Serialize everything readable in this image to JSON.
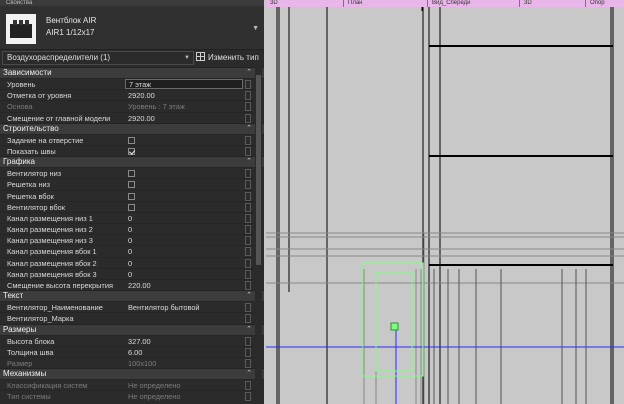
{
  "panel": {
    "title": "Свойства",
    "type_name": "Вентблок AIR",
    "type_sub": "AIR1 1/12x17",
    "filter": "Воздухораспределители (1)",
    "edit_type": "Изменить тип"
  },
  "sections": [
    {
      "title": "Зависимости",
      "rows": [
        {
          "label": "Уровень",
          "value": "7 этаж",
          "kind": "input"
        },
        {
          "label": "Отметка от уровня",
          "value": "2920.00"
        },
        {
          "label": "Основа",
          "value": "Уровень : 7 этаж",
          "kind": "disabled"
        },
        {
          "label": "Смещение от главной модели",
          "value": "2920.00"
        }
      ]
    },
    {
      "title": "Строительство",
      "rows": [
        {
          "label": "Задание на отверстие",
          "value": "",
          "kind": "checkbox",
          "checked": false
        },
        {
          "label": "Показать швы",
          "value": "",
          "kind": "checkbox",
          "checked": true
        }
      ]
    },
    {
      "title": "Графика",
      "rows": [
        {
          "label": "Вентилятор низ",
          "value": "",
          "kind": "checkbox",
          "checked": false
        },
        {
          "label": "Решетка низ",
          "value": "",
          "kind": "checkbox",
          "checked": false
        },
        {
          "label": "Решетка вбок",
          "value": "",
          "kind": "checkbox",
          "checked": false
        },
        {
          "label": "Вентилятор вбок",
          "value": "",
          "kind": "checkbox",
          "checked": false
        },
        {
          "label": "Канал размещения низ 1",
          "value": "0"
        },
        {
          "label": "Канал размещения низ 2",
          "value": "0"
        },
        {
          "label": "Канал размещения низ 3",
          "value": "0"
        },
        {
          "label": "Канал размещения вбок 1",
          "value": "0"
        },
        {
          "label": "Канал размещения вбок 2",
          "value": "0"
        },
        {
          "label": "Канал размещения вбок 3",
          "value": "0"
        },
        {
          "label": "Смещение высота перекрытия",
          "value": "220.00"
        }
      ]
    },
    {
      "title": "Текст",
      "rows": [
        {
          "label": "Вентилятор_Наименование",
          "value": "Вентилятор бытовой"
        },
        {
          "label": "Вентилятор_Марка",
          "value": ""
        }
      ]
    },
    {
      "title": "Размеры",
      "rows": [
        {
          "label": "Высота блока",
          "value": "327.00"
        },
        {
          "label": "Толщина шва",
          "value": "6.00"
        },
        {
          "label": "Размер",
          "value": "100x100",
          "kind": "disabled"
        }
      ]
    },
    {
      "title": "Механизмы",
      "rows": [
        {
          "label": "Классификация систем",
          "value": "Не определено",
          "kind": "disabled"
        },
        {
          "label": "Тип системы",
          "value": "Не определено",
          "kind": "disabled"
        }
      ]
    }
  ],
  "tabs": [
    "3D",
    "План",
    "Вид_Спереди",
    "3D",
    "Опор"
  ],
  "colors": {
    "panel_bg": "#2b2b2b",
    "section_bg": "#3c3c3c",
    "tab_bg": "#e8b6e8",
    "canvas_bg": "#c8c8c8",
    "selection": "#7cff7c",
    "axis": "#2a2aff"
  },
  "icons": [
    "collapse-icon",
    "edit-type-icon",
    "dropdown-icon"
  ]
}
